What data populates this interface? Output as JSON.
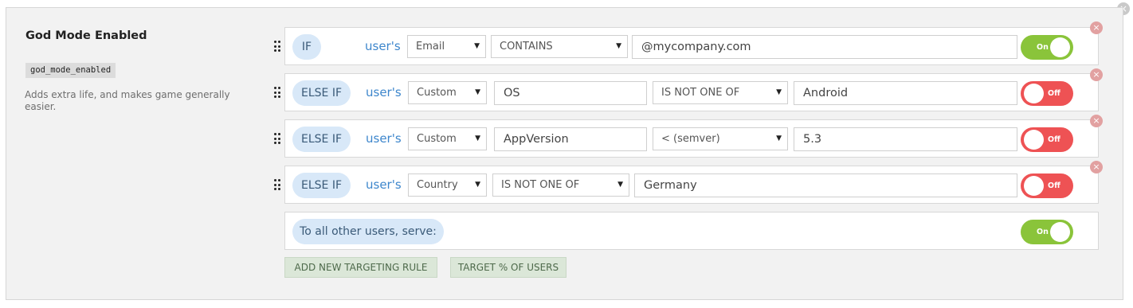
{
  "flag": {
    "name": "God Mode Enabled",
    "key": "god_mode_enabled",
    "description": "Adds extra life, and makes game generally easier."
  },
  "icons": {
    "close": "×",
    "dropdown_arrow": "▼",
    "drag_handle": "drag-handle-icon"
  },
  "rules": [
    {
      "condition": "IF",
      "subject": "user's",
      "attribute": "Email",
      "operator": "CONTAINS",
      "value": "@mycompany.com",
      "toggle": "On"
    },
    {
      "condition": "ELSE IF",
      "subject": "user's",
      "attribute": "Custom",
      "custom_attribute": "OS",
      "operator": "IS NOT ONE OF",
      "value": "Android",
      "toggle": "Off"
    },
    {
      "condition": "ELSE IF",
      "subject": "user's",
      "attribute": "Custom",
      "custom_attribute": "AppVersion",
      "operator": "< (semver)",
      "value": "5.3",
      "toggle": "Off"
    },
    {
      "condition": "ELSE IF",
      "subject": "user's",
      "attribute": "Country",
      "operator": "IS NOT ONE OF",
      "value": "Germany",
      "toggle": "Off"
    }
  ],
  "default_rule": {
    "label": "To all other users, serve:",
    "toggle": "On"
  },
  "buttons": {
    "add_rule": "ADD NEW TARGETING RULE",
    "target_percent": "TARGET % OF USERS"
  },
  "colors": {
    "toggle_on": "#8ac43a",
    "toggle_off": "#ee5254",
    "accent_blue": "#3d86cc",
    "pill_bg": "#d8e8f8",
    "button_bg": "#dbe7d8"
  }
}
